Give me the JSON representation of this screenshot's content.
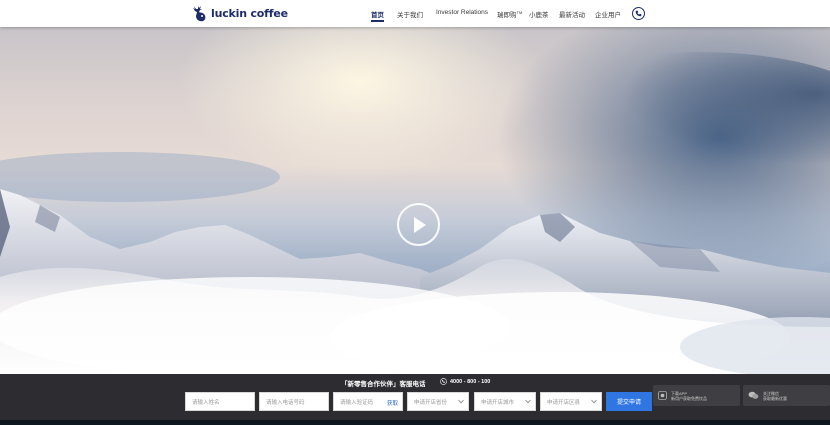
{
  "brand": {
    "name": "luckin coffee",
    "color": "#1d2b6b"
  },
  "nav": {
    "items": [
      {
        "label": "首页",
        "active": true
      },
      {
        "label": "关于我们",
        "active": false
      },
      {
        "label": "Investor Relations",
        "active": false
      },
      {
        "label": "瑞即购",
        "sup": "TM",
        "active": false
      },
      {
        "label": "小鹿茶",
        "active": false
      },
      {
        "label": "最新活动",
        "active": false
      },
      {
        "label": "企业用户",
        "active": false
      }
    ],
    "phone_icon": "phone-icon"
  },
  "hero": {
    "play_icon": "play-icon"
  },
  "partner": {
    "title": "「新零售合作伙伴」客服电话",
    "phone": "4000 - 800 - 100",
    "fields": [
      {
        "placeholder": "请输入姓名"
      },
      {
        "placeholder": "请输入电话号码"
      },
      {
        "placeholder": "请输入验证码",
        "action": "获取"
      },
      {
        "placeholder": "申请开店省份",
        "select": true
      },
      {
        "placeholder": "申请开店城市",
        "select": true
      },
      {
        "placeholder": "申请开店区县",
        "select": true
      }
    ],
    "submit": "提交申请"
  },
  "side_cards": [
    {
      "icon": "app-icon",
      "line1": "下载APP",
      "line2": "新用户获取免费饮品"
    },
    {
      "icon": "wechat-icon",
      "line1": "关注微信",
      "line2": "获取最新优惠"
    }
  ],
  "colors": {
    "accent": "#2f76e3",
    "bar": "#2d2d30"
  }
}
